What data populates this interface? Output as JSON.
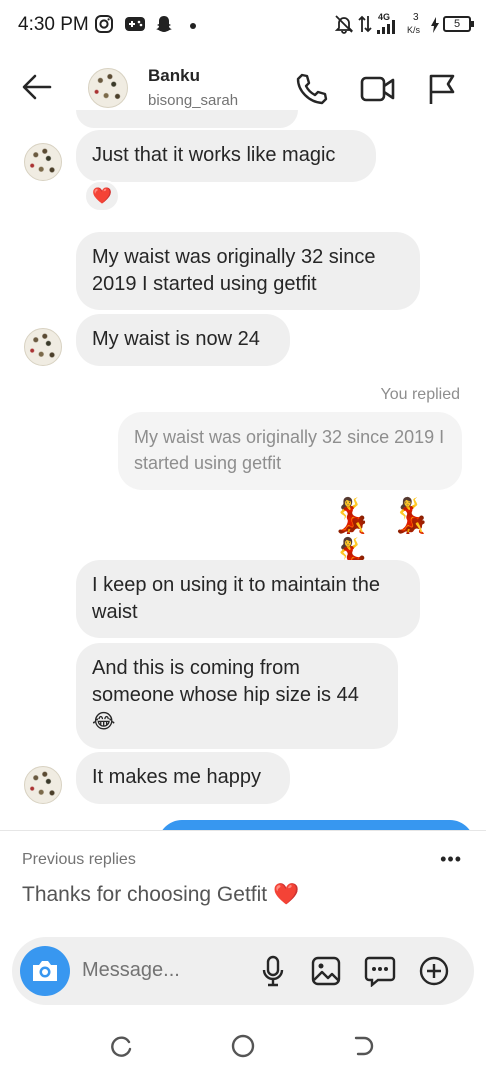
{
  "status_bar": {
    "time": "4:30 PM",
    "network_label": "4G",
    "speed_value": "3",
    "speed_unit": "K/s",
    "battery_level": "5"
  },
  "header": {
    "name": "Banku",
    "username": "bisong_sarah"
  },
  "messages": [
    {
      "text": "Just that it works like magic",
      "reaction": "❤️"
    },
    {
      "text": "My waist was originally 32 since 2019 I started using getfit"
    },
    {
      "text": "My waist is now 24"
    },
    {
      "replied_label": "You replied",
      "quoted_text": "My waist was originally 32 since 2019 I started using getfit",
      "reply_emojis": "💃 💃 💃"
    },
    {
      "text": "I keep on using it to maintain the waist"
    },
    {
      "text": "And this is coming from someone whose hip size is 44",
      "emoji": "😂"
    },
    {
      "text": "It makes me happy"
    }
  ],
  "suggestions": {
    "label": "Previous replies",
    "more_label": "•••",
    "quick_reply": "Thanks for choosing Getfit ❤️"
  },
  "composer": {
    "placeholder": "Message..."
  },
  "colors": {
    "accent_blue": "#3797f0",
    "bubble_gray": "#efefef",
    "heart_red": "#ed4956"
  }
}
